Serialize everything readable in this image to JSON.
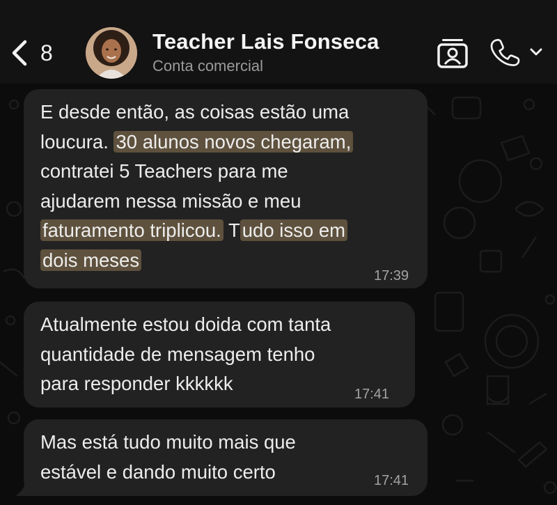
{
  "header": {
    "back_count": "8",
    "contact_name": "Teacher Lais Fonseca",
    "contact_subtitle": "Conta comercial"
  },
  "messages": [
    {
      "time": "17:39",
      "lines": [
        [
          "E desde então, as coisas estão uma"
        ],
        [
          "loucura. ",
          "30 alunos novos chegaram,"
        ],
        [
          "contratei 5 Teachers para me"
        ],
        [
          "ajudarem nessa missão e meu"
        ],
        [
          "faturamento triplicou.",
          " T",
          "udo isso em"
        ],
        [
          "dois meses"
        ]
      ]
    },
    {
      "time": "17:41",
      "lines": [
        "Atualmente estou doida com tanta",
        "quantidade de mensagem tenho",
        "para responder kkkkkk"
      ]
    },
    {
      "time": "17:41",
      "lines": [
        "Mas está tudo muito mais que",
        "estável e dando muito certo"
      ]
    }
  ],
  "colors": {
    "background": "#0c0c0c",
    "header": "#131313",
    "bubble": "#222222",
    "highlight": "#5e513d",
    "timestamp": "#a3a3a3"
  },
  "icons": [
    "chevron-left-icon",
    "contact-card-icon",
    "phone-icon",
    "chevron-down-icon"
  ]
}
